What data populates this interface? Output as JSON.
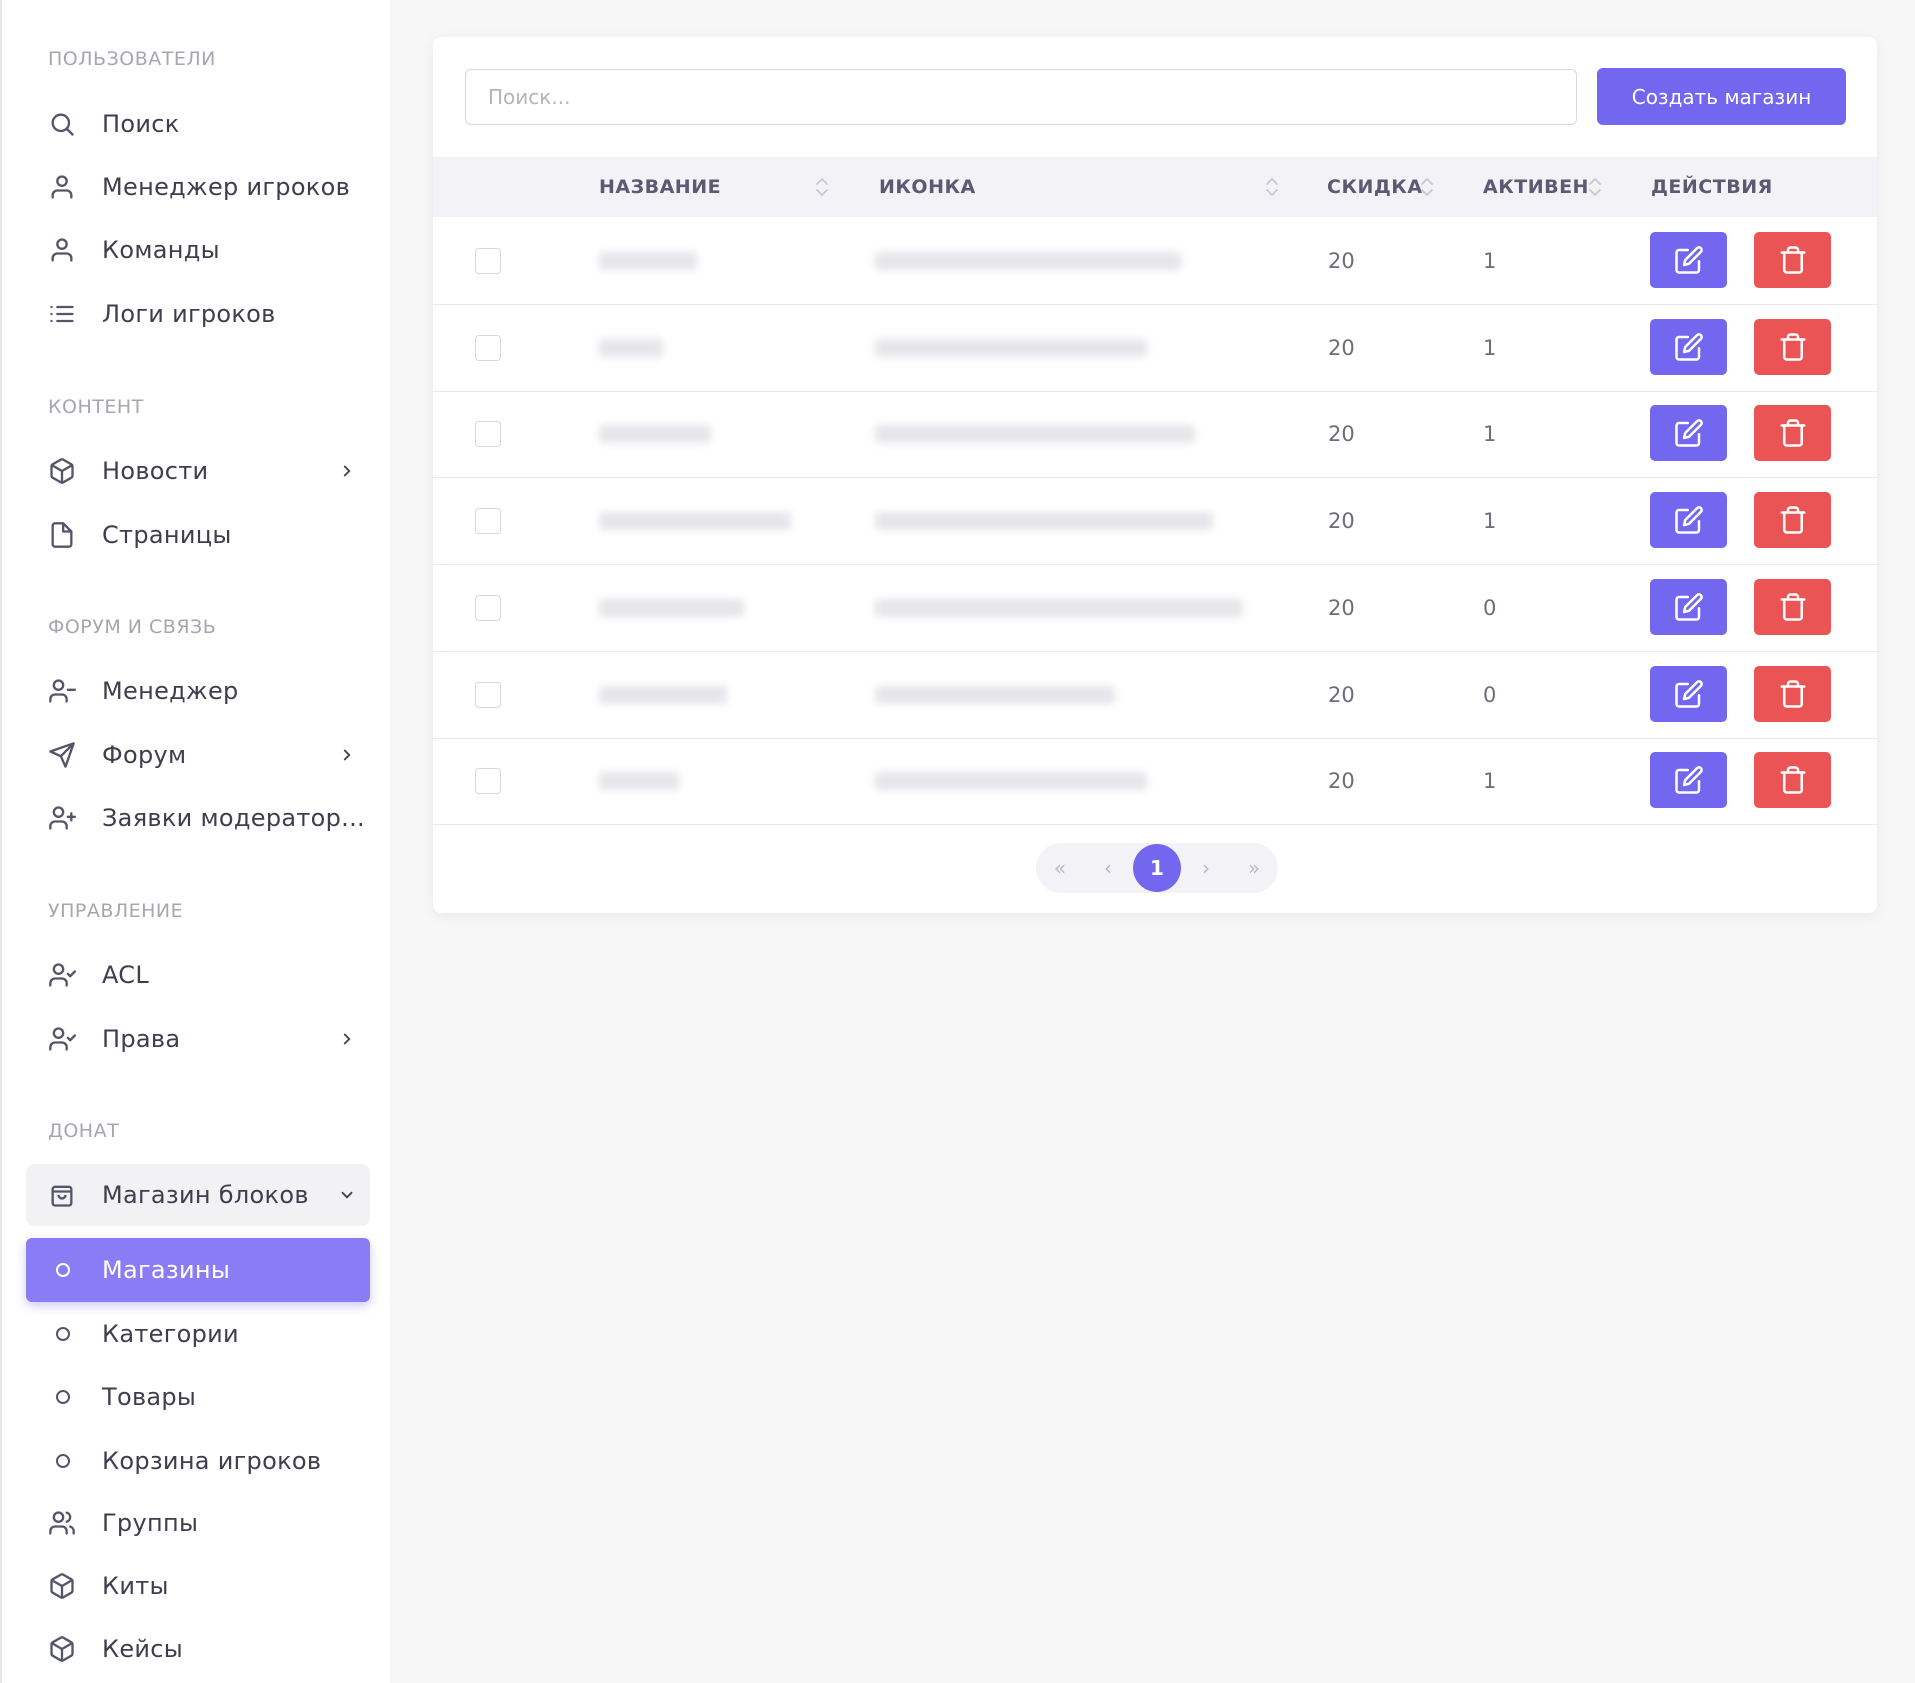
{
  "sidebar": {
    "sections": [
      {
        "title": "ПОЛЬЗОВАТЕЛИ"
      },
      {
        "title": "КОНТЕНТ"
      },
      {
        "title": "ФОРУМ И СВЯЗЬ"
      },
      {
        "title": "УПРАВЛЕНИЕ"
      },
      {
        "title": "ДОНАТ"
      }
    ],
    "items": [
      {
        "label": "Поиск",
        "icon": "search-icon"
      },
      {
        "label": "Менеджер игроков",
        "icon": "user-icon"
      },
      {
        "label": "Команды",
        "icon": "user-icon"
      },
      {
        "label": "Логи игроков",
        "icon": "list-icon"
      },
      {
        "label": "Новости",
        "icon": "box-icon"
      },
      {
        "label": "Страницы",
        "icon": "file-icon"
      },
      {
        "label": "Менеджер",
        "icon": "user-minus-icon"
      },
      {
        "label": "Форум",
        "icon": "send-icon"
      },
      {
        "label": "Заявки модератор...",
        "icon": "user-plus-icon"
      },
      {
        "label": "ACL",
        "icon": "user-check-icon"
      },
      {
        "label": "Права",
        "icon": "user-check-icon"
      },
      {
        "label": "Магазин блоков",
        "icon": "shopping-bag-icon"
      },
      {
        "label": "Магазины",
        "icon": "circle-icon",
        "active": true
      },
      {
        "label": "Категории",
        "icon": "circle-icon"
      },
      {
        "label": "Товары",
        "icon": "circle-icon"
      },
      {
        "label": "Корзина игроков",
        "icon": "circle-icon"
      },
      {
        "label": "Группы",
        "icon": "users-icon"
      },
      {
        "label": "Киты",
        "icon": "box-icon"
      },
      {
        "label": "Кейсы",
        "icon": "box-icon"
      }
    ]
  },
  "toolbar": {
    "search_placeholder": "Поиск...",
    "create_label": "Создать магазин"
  },
  "table": {
    "columns": [
      "НАЗВАНИЕ",
      "ИКОНКА",
      "СКИДКА",
      "АКТИВЕН",
      "ДЕЙСТВИЯ"
    ],
    "rows": [
      {
        "name": "████",
        "icon": "██████████████",
        "discount": "20",
        "active": "1"
      },
      {
        "name": "███",
        "icon": "█████████████",
        "discount": "20",
        "active": "1"
      },
      {
        "name": "█████",
        "icon": "███████████████",
        "discount": "20",
        "active": "1"
      },
      {
        "name": "████████",
        "icon": "████████████████",
        "discount": "20",
        "active": "1"
      },
      {
        "name": "██████",
        "icon": "█████████████████",
        "discount": "20",
        "active": "0"
      },
      {
        "name": "██████",
        "icon": "███████████",
        "discount": "20",
        "active": "0"
      },
      {
        "name": "████",
        "icon": "█████████████",
        "discount": "20",
        "active": "1"
      }
    ]
  },
  "pagination": {
    "first": "«",
    "prev": "‹",
    "current": "1",
    "next": "›",
    "last": "»"
  },
  "colors": {
    "primary": "#7367f0",
    "danger": "#ea5455",
    "active_item": "#8a7cf5"
  }
}
